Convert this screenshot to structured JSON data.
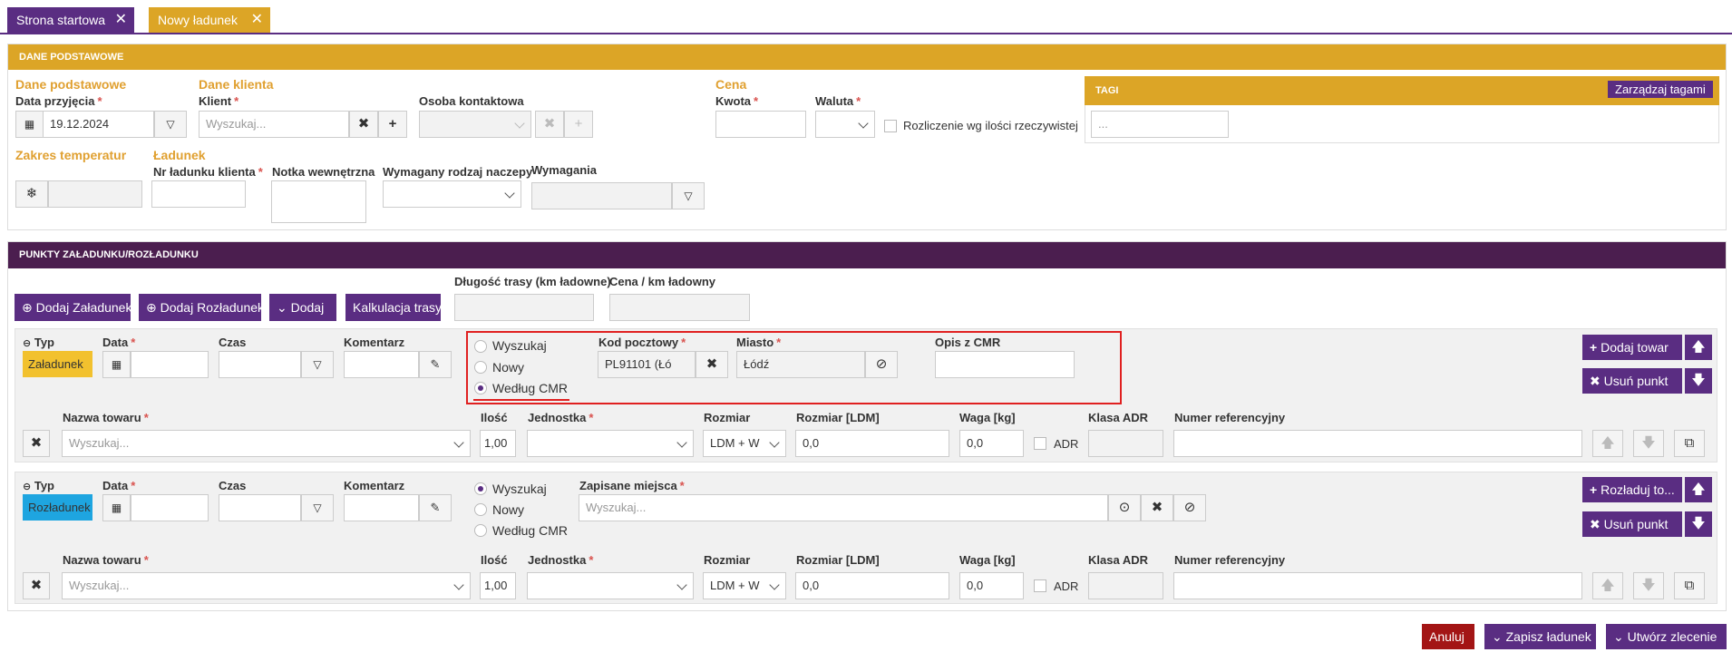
{
  "tabs": [
    {
      "label": "Strona startowa"
    },
    {
      "label": "Nowy ładunek"
    }
  ],
  "colors": {
    "purple": "#5a2d82",
    "gold": "#dca526",
    "dark_purple": "#4b1e4f",
    "red": "#a31515",
    "load": "#f2c12e",
    "unload": "#1ea5e0"
  },
  "basic": {
    "header": "DANE PODSTAWOWE",
    "sec_basic": "Dane podstawowe",
    "sec_client": "Dane klienta",
    "sec_price": "Cena",
    "sec_temp": "Zakres temperatur",
    "sec_cargo": "Ładunek",
    "date_label": "Data przyjęcia",
    "date_value": "19.12.2024",
    "client_label": "Klient",
    "client_ph": "Wyszukaj...",
    "contact_label": "Osoba kontaktowa",
    "amount_label": "Kwota",
    "currency_label": "Waluta",
    "settle_label": "Rozliczenie wg ilości rzeczywistej",
    "cargo_no_label": "Nr ładunku klienta",
    "note_label": "Notka wewnętrzna",
    "trailer_label": "Wymagany rodzaj naczepy",
    "req_label": "Wymagania"
  },
  "tags": {
    "header": "TAGI",
    "manage": "Zarządzaj tagami",
    "ph": "..."
  },
  "points": {
    "header": "PUNKTY ZAŁADUNKU/ROZŁADUNKU",
    "add_load": "Dodaj Załadunek",
    "add_unload": "Dodaj Rozładunek",
    "add": "Dodaj",
    "calc": "Kalkulacja trasy",
    "route_len": "Długość trasy (km ładowne)",
    "price_km": "Cena / km ładowny"
  },
  "labels": {
    "type": "Typ",
    "date": "Data",
    "time": "Czas",
    "comment": "Komentarz",
    "search": "Wyszukaj",
    "new": "Nowy",
    "by_cmr": "Według CMR",
    "postal": "Kod pocztowy",
    "city": "Miasto",
    "cmr_desc": "Opis z CMR",
    "saved": "Zapisane miejsca",
    "goods": "Nazwa towaru",
    "qty": "Ilość",
    "unit": "Jednostka",
    "size": "Rozmiar",
    "size_ldm": "Rozmiar [LDM]",
    "weight": "Waga [kg]",
    "adr_class": "Klasa ADR",
    "ref_no": "Numer referencyjny",
    "adr": "ADR",
    "search_ph": "Wyszukaj..."
  },
  "stop1": {
    "type": "Załadunek",
    "postal": "PL91101 (Łó",
    "city": "Łódź",
    "add_goods": "Dodaj towar",
    "remove": "Usuń punkt",
    "qty": "1,00",
    "size": "LDM + W",
    "ldm": "0,0",
    "weight": "0,0"
  },
  "stop2": {
    "type": "Rozładunek",
    "unload_to": "Rozładuj to...",
    "remove": "Usuń punkt",
    "qty": "1,00",
    "size": "LDM + W",
    "ldm": "0,0",
    "weight": "0,0"
  },
  "footer": {
    "cancel": "Anuluj",
    "save": "Zapisz ładunek",
    "create": "Utwórz zlecenie"
  }
}
